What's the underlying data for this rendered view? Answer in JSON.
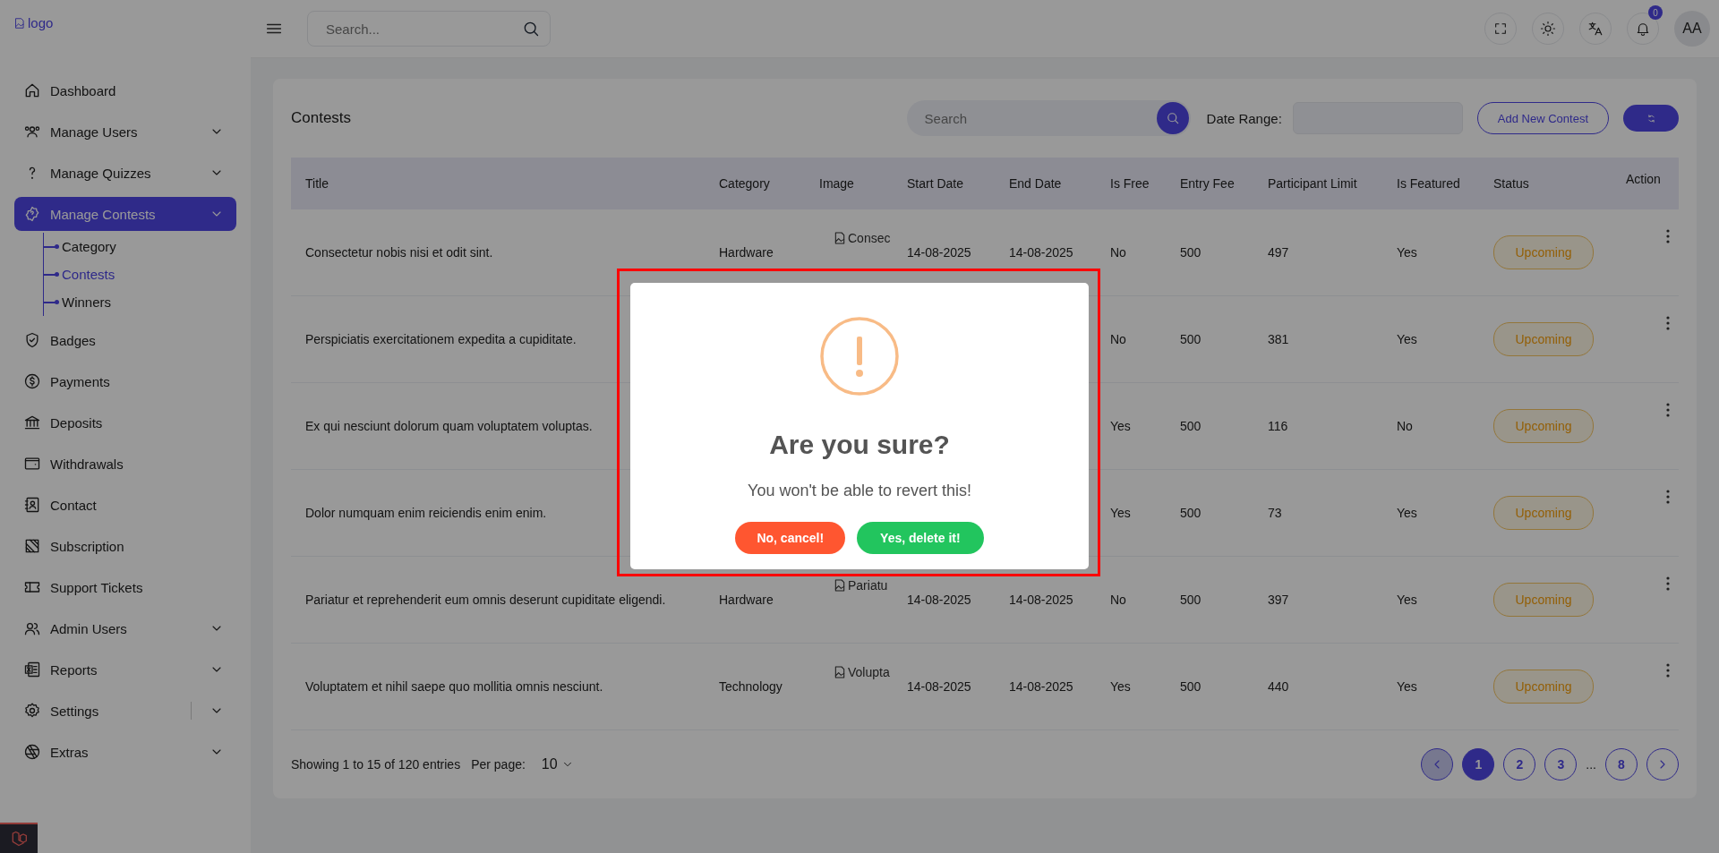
{
  "topbar": {
    "logo_alt": "logo",
    "search": {
      "placeholder": "Search..."
    },
    "notifications": {
      "count": "0"
    },
    "avatar": {
      "initials": "AA"
    }
  },
  "sidebar": {
    "items": [
      {
        "label": "Dashboard",
        "expandable": false,
        "selected": false
      },
      {
        "label": "Manage Users",
        "expandable": true,
        "selected": false
      },
      {
        "label": "Manage Quizzes",
        "expandable": true,
        "selected": false
      },
      {
        "label": "Manage Contests",
        "expandable": true,
        "selected": true,
        "expanded": true,
        "children": [
          {
            "label": "Category",
            "selected": false
          },
          {
            "label": "Contests",
            "selected": true
          },
          {
            "label": "Winners",
            "selected": false
          }
        ]
      },
      {
        "label": "Badges",
        "expandable": false,
        "selected": false
      },
      {
        "label": "Payments",
        "expandable": false,
        "selected": false
      },
      {
        "label": "Deposits",
        "expandable": false,
        "selected": false
      },
      {
        "label": "Withdrawals",
        "expandable": false,
        "selected": false
      },
      {
        "label": "Contact",
        "expandable": false,
        "selected": false
      },
      {
        "label": "Subscription",
        "expandable": false,
        "selected": false
      },
      {
        "label": "Support Tickets",
        "expandable": false,
        "selected": false
      },
      {
        "label": "Admin Users",
        "expandable": true,
        "selected": false
      },
      {
        "label": "Reports",
        "expandable": true,
        "selected": false
      },
      {
        "label": "Settings",
        "expandable": true,
        "selected": false
      },
      {
        "label": "Extras",
        "expandable": true,
        "selected": false
      }
    ]
  },
  "card": {
    "title": "Contests",
    "search": {
      "placeholder": "Search"
    },
    "date_range_label": "Date Range:",
    "add_button": "Add New Contest"
  },
  "table": {
    "columns": [
      "Title",
      "Category",
      "Image",
      "Start Date",
      "End Date",
      "Is Free",
      "Entry Fee",
      "Participant Limit",
      "Is Featured",
      "Status",
      "Action"
    ],
    "rows": [
      {
        "title": "Consectetur nobis nisi et odit sint.",
        "category": "Hardware",
        "image_alt": "Consec",
        "start_date": "14-08-2025",
        "end_date": "14-08-2025",
        "is_free": "No",
        "entry_fee": "500",
        "participant_limit": "497",
        "is_featured": "Yes",
        "status": "Upcoming"
      },
      {
        "title": "Perspiciatis exercitationem expedita a cupiditate.",
        "is_free": "No",
        "entry_fee": "500",
        "participant_limit": "381",
        "is_featured": "Yes",
        "status": "Upcoming"
      },
      {
        "title": "Ex qui nesciunt dolorum quam voluptatem voluptas.",
        "is_free": "Yes",
        "entry_fee": "500",
        "participant_limit": "116",
        "is_featured": "No",
        "status": "Upcoming"
      },
      {
        "title": "Dolor numquam enim reiciendis enim enim.",
        "is_free": "Yes",
        "entry_fee": "500",
        "participant_limit": "73",
        "is_featured": "Yes",
        "status": "Upcoming"
      },
      {
        "title": "Pariatur et reprehenderit eum omnis deserunt cupiditate eligendi.",
        "category": "Hardware",
        "image_alt": "Pariatu",
        "start_date": "14-08-2025",
        "end_date": "14-08-2025",
        "is_free": "No",
        "entry_fee": "500",
        "participant_limit": "397",
        "is_featured": "Yes",
        "status": "Upcoming"
      },
      {
        "title": "Voluptatem et nihil saepe quo mollitia omnis nesciunt.",
        "category": "Technology",
        "image_alt": "Volupta",
        "start_date": "14-08-2025",
        "end_date": "14-08-2025",
        "is_free": "Yes",
        "entry_fee": "500",
        "participant_limit": "440",
        "is_featured": "Yes",
        "status": "Upcoming"
      }
    ]
  },
  "footer": {
    "summary": "Showing 1 to 15 of 120 entries",
    "per_page_label": "Per page:",
    "per_page_value": "10",
    "pagination": [
      {
        "kind": "prev",
        "disabled": true
      },
      {
        "kind": "page",
        "label": "1",
        "selected": true
      },
      {
        "kind": "page",
        "label": "2",
        "selected": false
      },
      {
        "kind": "page",
        "label": "3",
        "selected": false
      },
      {
        "kind": "ellipsis",
        "label": "..."
      },
      {
        "kind": "page",
        "label": "8",
        "selected": false
      },
      {
        "kind": "next",
        "disabled": false
      }
    ]
  },
  "dialog": {
    "title": "Are you sure?",
    "message": "You won't be able to revert this!",
    "cancel_button": "No, cancel!",
    "confirm_button": "Yes, delete it!"
  }
}
